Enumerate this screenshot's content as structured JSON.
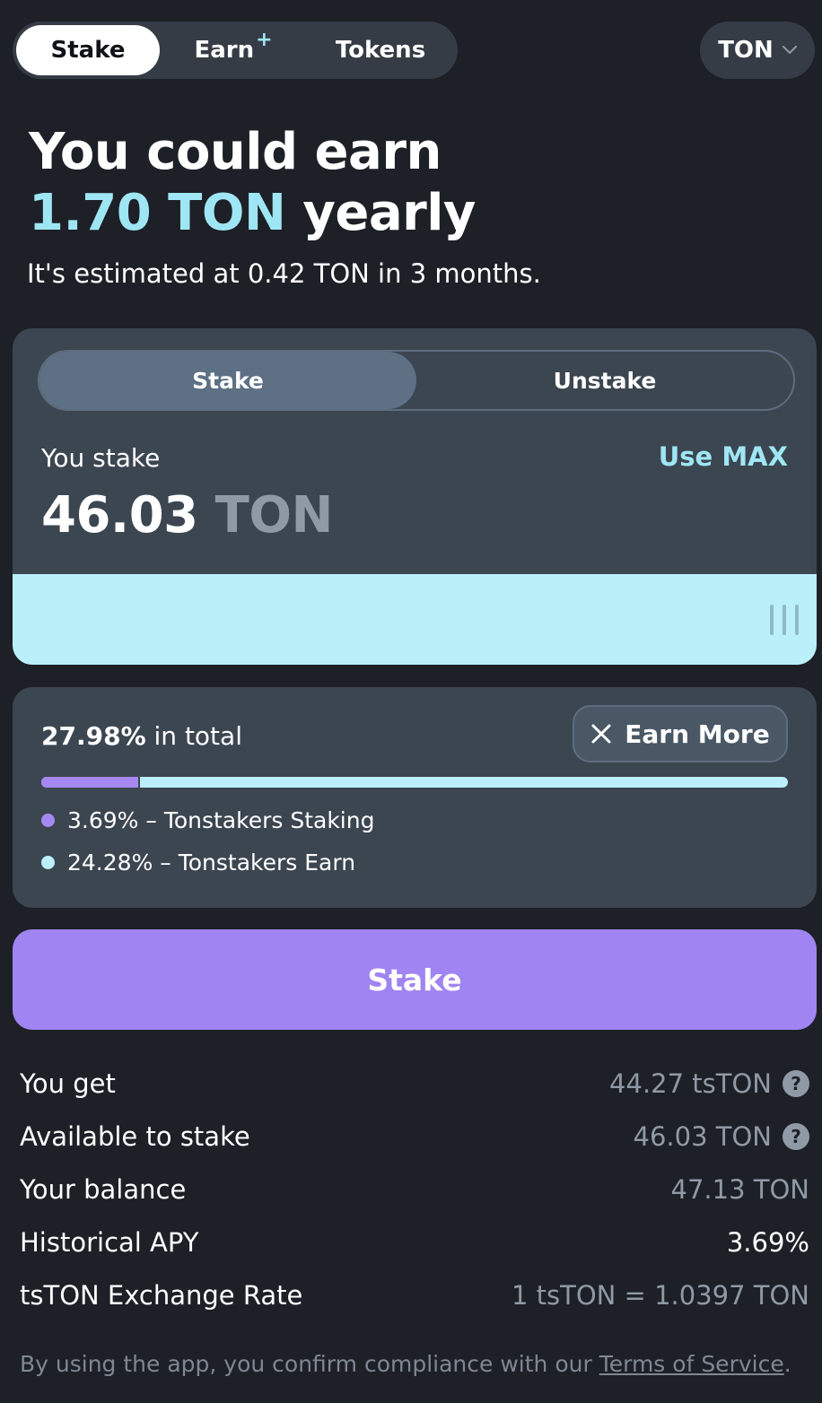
{
  "nav": {
    "tabs": [
      "Stake",
      "Earn",
      "Tokens"
    ],
    "earn_badge": "+",
    "token": "TON"
  },
  "headline": {
    "line1": "You could earn",
    "amount": "1.70 TON",
    "suffix": " yearly",
    "subline": "It's estimated at 0.42 TON in 3 months."
  },
  "stake_form": {
    "modes": [
      "Stake",
      "Unstake"
    ],
    "active_mode": "Stake",
    "label": "You stake",
    "use_max": "Use MAX",
    "amount": "46.03",
    "unit": " TON",
    "slider_fraction": 1.0
  },
  "apy": {
    "total_value": "27.98%",
    "total_suffix": " in total",
    "earn_more": "Earn More",
    "staking_fraction": 0.132,
    "legend": [
      {
        "text": "3.69% – Tonstakers Staking",
        "color": "#a688f2"
      },
      {
        "text": "24.28% – Tonstakers Earn",
        "color": "#bbf0fb"
      }
    ]
  },
  "stake_button": "Stake",
  "info": [
    {
      "label": "You get",
      "value": "44.27 tsTON",
      "help": "?"
    },
    {
      "label": "Available to stake",
      "value": "46.03 TON",
      "help": "?"
    },
    {
      "label": "Your balance",
      "value": "47.13 TON"
    },
    {
      "label": "Historical APY",
      "value": "3.69%"
    },
    {
      "label": "tsTON Exchange Rate",
      "value": "1 tsTON = 1.0397 TON"
    }
  ],
  "footer": {
    "text": "By using the app, you confirm compliance with our ",
    "link": "Terms of Service",
    "end": "."
  },
  "colors": {
    "accent_cyan": "#9fe6f4",
    "accent_purple": "#a084f2",
    "background": "#1d2026",
    "card": "#3c4651"
  }
}
